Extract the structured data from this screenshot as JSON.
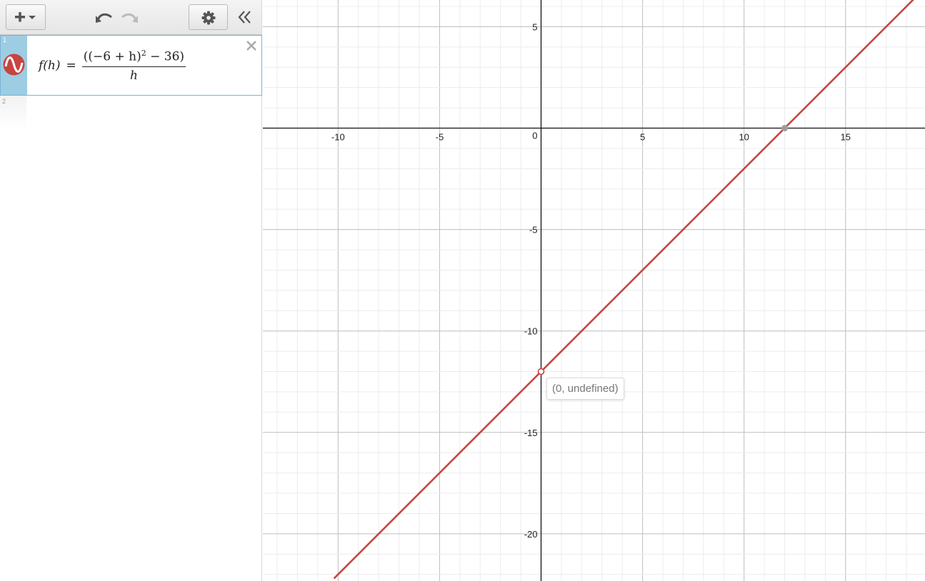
{
  "toolbar": {
    "add_icon": "plus-with-caret-icon",
    "undo_icon": "undo-icon",
    "redo_icon": "redo-icon",
    "settings_icon": "gear-icon",
    "collapse_icon": "double-chevron-left-icon"
  },
  "expressions": [
    {
      "number": "1",
      "color": "#c74440",
      "lhs": "f(h)",
      "equals": "=",
      "numerator": "((−6 + h)",
      "exponent": "2",
      "numerator_tail": " − 36)",
      "denominator": "h"
    },
    {
      "number": "2"
    }
  ],
  "graph": {
    "x_ticks": [
      "-10",
      "-5",
      "5",
      "10",
      "15"
    ],
    "y_ticks": [
      "5",
      "-5",
      "-10",
      "-15",
      "-20"
    ],
    "origin_label": "0",
    "tooltip": "(0, undefined)",
    "hole_point": [
      0,
      -12
    ],
    "x_intercept_point": [
      12,
      0
    ]
  },
  "chart_data": {
    "type": "line",
    "series": [
      {
        "expression": "f(h) = ((−6+h)^2 − 36)/h",
        "x": [
          -10.2,
          18.5
        ],
        "y": [
          -22.2,
          6.5
        ]
      }
    ],
    "xlim": [
      -13.7,
      18.9
    ],
    "ylim": [
      -22.3,
      6.3
    ],
    "grid": true
  }
}
